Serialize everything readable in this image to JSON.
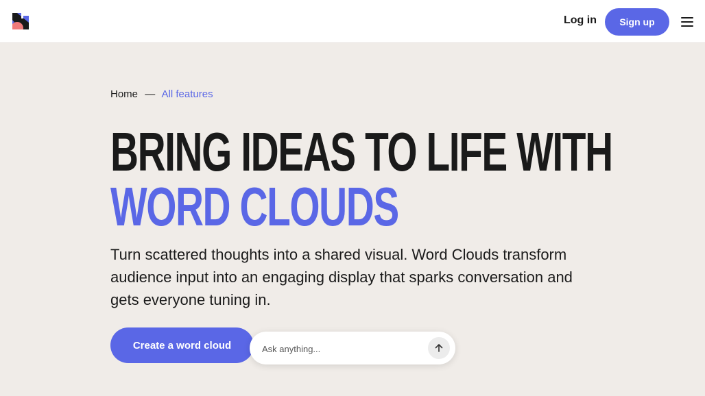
{
  "header": {
    "logo_icon": "mentimeter-logo-icon",
    "login_label": "Log in",
    "signup_label": "Sign up",
    "menu_icon": "hamburger-menu-icon"
  },
  "breadcrumb": {
    "home": "Home",
    "separator": "—",
    "current": "All features"
  },
  "hero": {
    "title_line1": "BRING IDEAS TO LIFE WITH",
    "title_line2": "WORD CLOUDS",
    "subtitle": "Turn scattered thoughts into a shared visual. Word Clouds transform audience input into an engaging display that sparks conversation and gets everyone tuning in.",
    "cta_label": "Create a word cloud",
    "ask_placeholder": "Ask anything...",
    "send_icon": "arrow-up-icon"
  },
  "colors": {
    "accent": "#5a67e6",
    "background": "#f0ece8",
    "header_bg": "#ffffff",
    "text": "#1a1a1a"
  }
}
